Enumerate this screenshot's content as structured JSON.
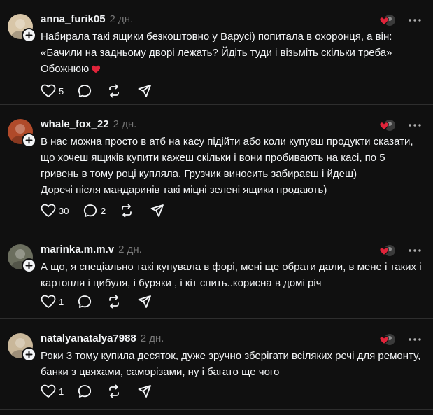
{
  "posts": [
    {
      "username": "anna_furik05",
      "time": "2 дн.",
      "avatar_color": "#d8c6a8",
      "lines": [
        "Набирала такі ящики безкоштовно у Варусі) попитала в охоронця, а він:",
        "«Бачили на задньому дворі лежать? Йдіть туди і візьміть скільки треба»",
        "Обожнюю"
      ],
      "trailing_emoji": "red-heart",
      "likes": "5",
      "replies": ""
    },
    {
      "username": "whale_fox_22",
      "time": "2 дн.",
      "avatar_color": "#b04a2a",
      "lines": [
        "В нас можна просто в атб на касу підійти або коли купуєш продукти сказати,",
        "що хочеш ящиків купити кажеш скільки і вони пробивають на касі, по 5",
        "гривень в тому році купляла. Грузчик виносить забираєш і йдеш)",
        "Доречі після мандаринів такі міцні зелені ящики продають)"
      ],
      "likes": "30",
      "replies": "2"
    },
    {
      "username": "marinka.m.m.v",
      "time": "2 дн.",
      "avatar_color": "#6b6e5e",
      "lines": [
        "А що, я спеціально такі купувала в форі, мені ще обрати дали, в мене і таких і",
        "картопля і цибуля, і буряки , і кіт спить..корисна в домі річ"
      ],
      "likes": "1",
      "replies": ""
    },
    {
      "username": "natalyanatalya7988",
      "time": "2 дн.",
      "avatar_color": "#c9b79a",
      "lines": [
        "Роки 3 тому купила десяток, дуже зручно зберігати всіляких речі для ремонту,",
        "банки з цвяхами, саморізами, ну і багато ще чого"
      ],
      "likes": "1",
      "replies": ""
    }
  ],
  "colors": {
    "background": "#101010",
    "text": "#f3f5f7",
    "muted": "#777777",
    "divider": "#2e2e2e",
    "heart": "#e0243a"
  }
}
